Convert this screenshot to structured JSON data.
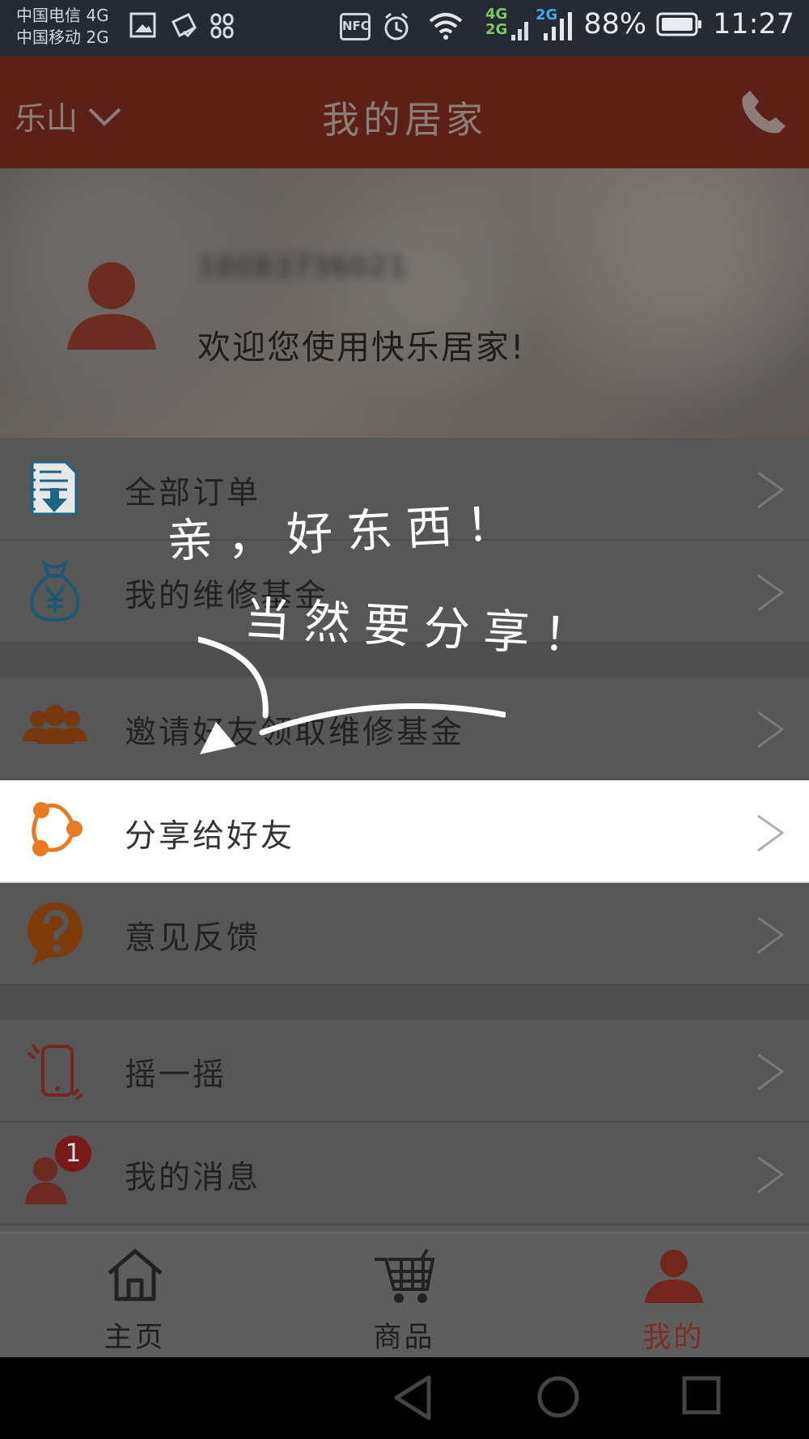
{
  "status": {
    "carrier_1": "中国电信 4G",
    "carrier_2": "中国移动 2G",
    "nfc": "NFC",
    "signal_4g": "4G",
    "signal_2g_top": "2G",
    "signal_2g": "2G",
    "battery": "88%",
    "time": "11:27"
  },
  "header": {
    "city": "乐山",
    "title": "我的居家"
  },
  "profile": {
    "phone": "18083736021",
    "welcome": "欢迎您使用快乐居家!"
  },
  "menu": {
    "orders": "全部订单",
    "fund": "我的维修基金",
    "invite": "邀请好友领取维修基金",
    "share": "分享给好友",
    "feedback": "意见反馈",
    "shake": "摇一摇",
    "messages": "我的消息",
    "message_badge": "1"
  },
  "overlay": {
    "line_1": "亲，好东西！",
    "line_2": "当然要分享！"
  },
  "tabs": {
    "home": "主页",
    "products": "商品",
    "mine": "我的"
  },
  "colors": {
    "header": "#5c2016",
    "accent": "#7b2e24",
    "highlight": "#ffffff"
  }
}
